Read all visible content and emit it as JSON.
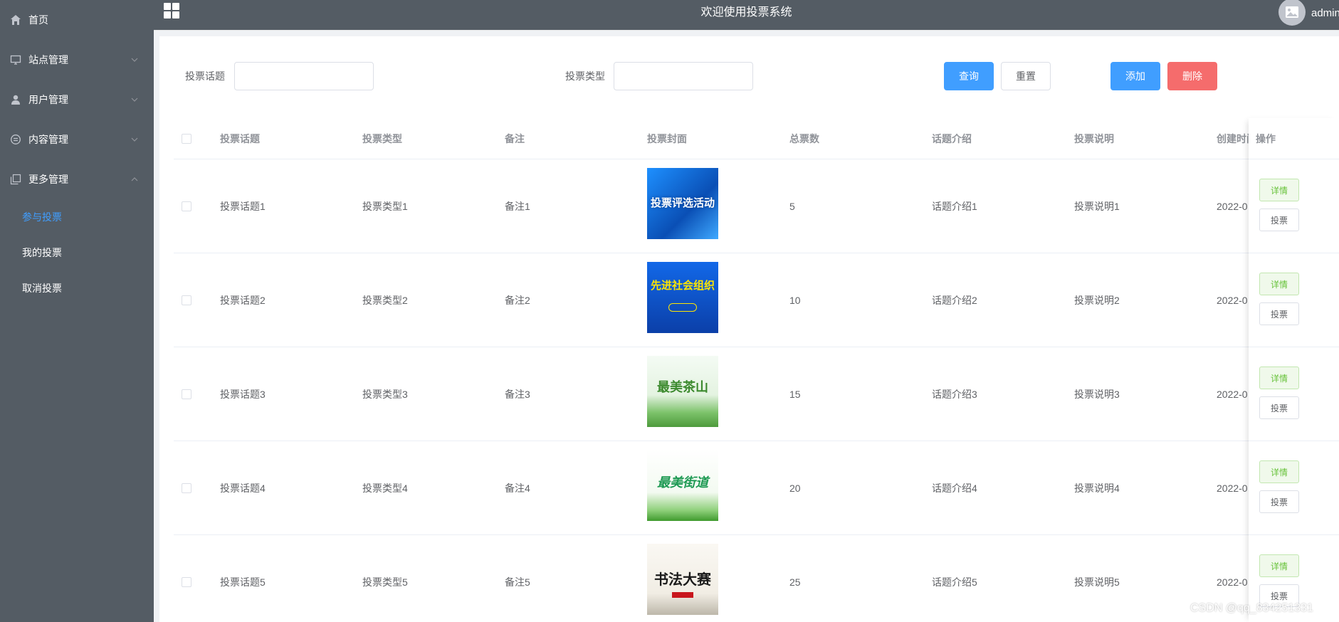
{
  "header": {
    "title": "欢迎使用投票系统",
    "username": "admin"
  },
  "sidebar": {
    "items": [
      {
        "label": "首页",
        "icon": "home-icon"
      },
      {
        "label": "站点管理",
        "icon": "monitor-icon"
      },
      {
        "label": "用户管理",
        "icon": "user-icon"
      },
      {
        "label": "内容管理",
        "icon": "chat-icon"
      },
      {
        "label": "更多管理",
        "icon": "copy-icon"
      }
    ],
    "subitems": [
      {
        "label": "参与投票",
        "active": true
      },
      {
        "label": "我的投票",
        "active": false
      },
      {
        "label": "取消投票",
        "active": false
      }
    ]
  },
  "search": {
    "topic_label": "投票话题",
    "topic_value": "",
    "type_label": "投票类型",
    "type_value": "",
    "query_button": "查询",
    "reset_button": "重置",
    "add_button": "添加",
    "delete_button": "删除"
  },
  "table": {
    "headers": [
      "投票话题",
      "投票类型",
      "备注",
      "投票封面",
      "总票数",
      "话题介绍",
      "投票说明",
      "创建时间",
      "操作"
    ],
    "rows": [
      {
        "topic": "投票话题1",
        "type": "投票类型1",
        "note": "备注1",
        "cover_text": "投票评选活动",
        "votes": "5",
        "intro": "话题介绍1",
        "desc": "投票说明1",
        "created": "2022-0"
      },
      {
        "topic": "投票话题2",
        "type": "投票类型2",
        "note": "备注2",
        "cover_text": "先进社会组织",
        "votes": "10",
        "intro": "话题介绍2",
        "desc": "投票说明2",
        "created": "2022-0"
      },
      {
        "topic": "投票话题3",
        "type": "投票类型3",
        "note": "备注3",
        "cover_text": "最美茶山",
        "votes": "15",
        "intro": "话题介绍3",
        "desc": "投票说明3",
        "created": "2022-0"
      },
      {
        "topic": "投票话题4",
        "type": "投票类型4",
        "note": "备注4",
        "cover_text": "最美街道",
        "votes": "20",
        "intro": "话题介绍4",
        "desc": "投票说明4",
        "created": "2022-0"
      },
      {
        "topic": "投票话题5",
        "type": "投票类型5",
        "note": "备注5",
        "cover_text": "书法大赛",
        "votes": "25",
        "intro": "话题介绍5",
        "desc": "投票说明5",
        "created": "2022-0"
      }
    ],
    "detail_button": "详情",
    "vote_button": "投票"
  },
  "watermark": "CSDN @qq_834251331",
  "colors": {
    "sidebar": "#545c64",
    "primary": "#409eff",
    "danger": "#f56c6c",
    "success": "#67c23a"
  }
}
